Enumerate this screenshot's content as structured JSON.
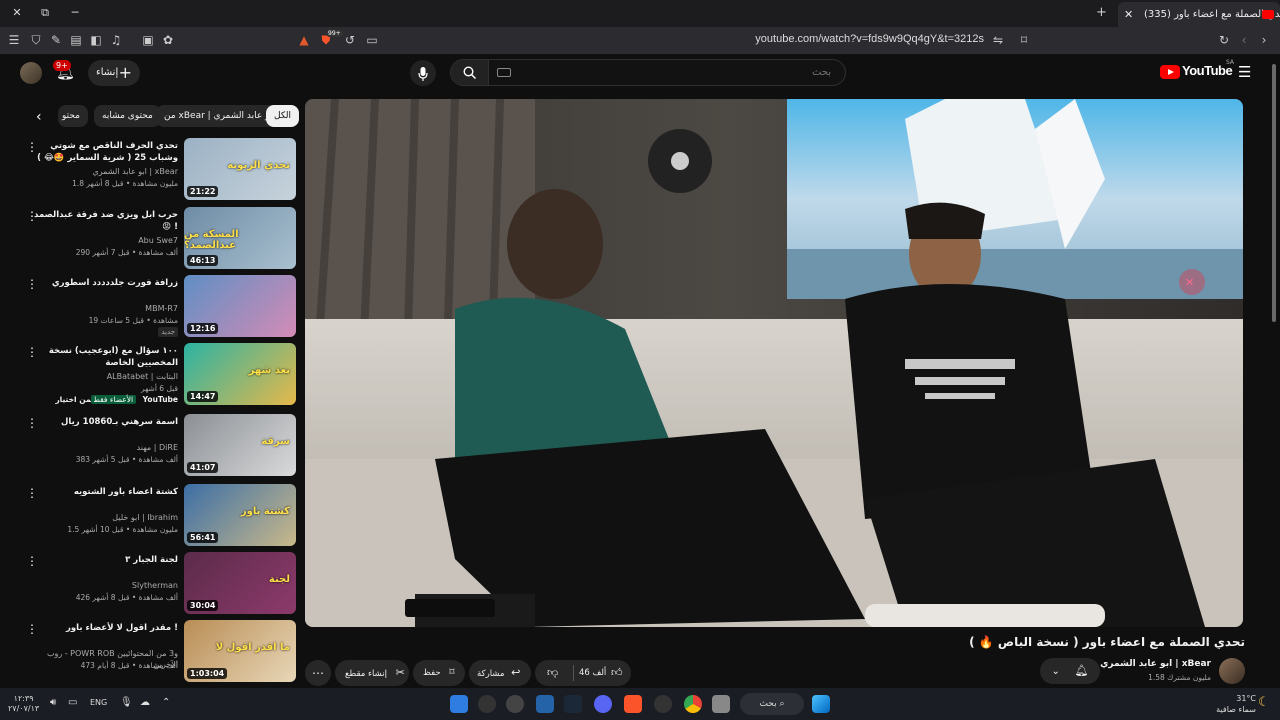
{
  "browser": {
    "tab_title": "(335) تحدي الصملة مع اعضاء باور",
    "url": "youtube.com/watch?v=fds9w9Qq4gY&t=3212s",
    "minimize": "─",
    "restore": "⧉",
    "close": "✕",
    "new_tab": "+",
    "tab_close": "✕",
    "badge_count": "99+"
  },
  "header": {
    "logo_text": "YouTube",
    "logo_region": "SA",
    "search_placeholder": "بحث",
    "create_label": "إنشاء",
    "notification_count": "9+"
  },
  "chips": [
    "الكل",
    "من xBear | ابو عابد الشمري",
    "محتوى مشابه",
    "محتو"
  ],
  "recommendations": [
    {
      "title": "تحدي الحرف الناقص مع شوتي وشباب 25 ( شرية السماير 🤩😂 )",
      "channel": "ابو عابد الشمري | xBear",
      "meta": "1.8 مليون مشاهدة • قبل 8 أشهر",
      "duration": "21:22",
      "thumb_colors": [
        "#9bb1c4",
        "#c7d3dc"
      ],
      "thumb_text": "تحدي الزبونه"
    },
    {
      "title": "حرب ابل ويزي ضد فرقة عبدالصمد 😡 !",
      "channel": "Abu Swe7",
      "meta": "290 ألف مشاهدة • قبل 7 أشهر",
      "duration": "46:13",
      "thumb_colors": [
        "#6e8ca6",
        "#a9c0cf"
      ],
      "thumb_text": "المسكة من عبدالصمد؟"
    },
    {
      "title": "زرافة فورت جلددددد اسطوري",
      "channel": "MBM-R7",
      "meta": "19 مشاهدة • قبل 5 ساعات",
      "badge": "جديد",
      "duration": "12:16",
      "thumb_colors": [
        "#5f8fc4",
        "#d48bb6"
      ],
      "thumb_text": ""
    },
    {
      "title": "١٠٠ سؤال مع (ابوعجيب) نسخة المخصيين الخاصة",
      "channel": "ALBatabet | البتابت",
      "meta": "قبل 6 أشهر",
      "extra": "من اختيار YouTube",
      "extra_badge": "الأعضاء فقط",
      "duration": "14:47",
      "thumb_colors": [
        "#2bb3a3",
        "#e6b84a"
      ],
      "thumb_text": "بعد شهر"
    },
    {
      "title": "اسمة سرهني بـ10860 ريال",
      "channel": "مهند | DiRE",
      "meta": "383 ألف مشاهدة • قبل 5 أشهر",
      "duration": "41:07",
      "thumb_colors": [
        "#8b8f94",
        "#d9dadb"
      ],
      "thumb_text": "سرقة"
    },
    {
      "title": "كشتة اعضاء باور الشتويه",
      "channel": "ابو خليل | Ibrahim",
      "meta": "1.5 مليون مشاهدة • قبل 10 أشهر",
      "duration": "56:41",
      "thumb_colors": [
        "#3b6ea6",
        "#c9b98a"
      ],
      "thumb_text": "كشتة باور"
    },
    {
      "title": "لجنة الجبار ٣",
      "channel": "Slytherman",
      "meta": "426 ألف مشاهدة • قبل 8 أشهر",
      "duration": "30:04",
      "thumb_colors": [
        "#5b2b4a",
        "#8d3a6b"
      ],
      "thumb_text": "لجنة"
    },
    {
      "title": "مقدر اقول لا لأعضاء باور !",
      "channel": "روب - POWR ROB و3 من المحتوائيين الآخرين",
      "meta": "473 ألف مشاهدة • قبل 8 أيام",
      "duration": "1:03:04",
      "thumb_colors": [
        "#b98d55",
        "#e8d7b8"
      ],
      "thumb_text": "ما اقدر اقول لا"
    }
  ],
  "video": {
    "title": "تحدي الصملة مع اعضاء باور ( نسخة الباص 🔥 )",
    "channel_name": "ابو عابد الشمري | xBear",
    "subscribers": "1.58 مليون مشترك",
    "likes": "46 ألف",
    "share_label": "مشاركة",
    "save_label": "حفظ",
    "clip_label": "إنشاء مقطع"
  },
  "taskbar": {
    "weather_temp": "31°C",
    "weather_desc": "سماء صافية",
    "search_label": "بحث",
    "language": "ENG",
    "time": "١٢:٣٩",
    "date": "٢٧/٠٧/١٣"
  }
}
